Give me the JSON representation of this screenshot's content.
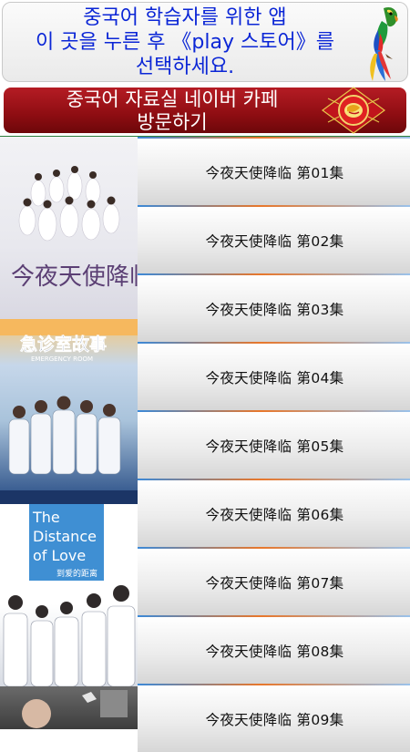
{
  "top_banner": {
    "line1": "중국어 학습자를 위한 앱",
    "line2": "이 곳을 누른 후 《play 스토어》를",
    "line3": "선택하세요.",
    "icon": "parrot-icon"
  },
  "cafe_banner": {
    "line1": "중국어 자료실 네이버 카페",
    "line2": "방문하기",
    "icon": "lantern-emblem-icon"
  },
  "posters": [
    {
      "title": "今夜天使降临"
    },
    {
      "title": "急诊室故事",
      "subtitle": "EMERGENCY ROOM"
    },
    {
      "title_line1": "The",
      "title_line2": "Distance",
      "title_line3": "of Love",
      "subtitle": "到爱的距离"
    },
    {
      "title": ""
    }
  ],
  "episodes": [
    {
      "label": "今夜天使降临 第01集"
    },
    {
      "label": "今夜天使降临 第02集"
    },
    {
      "label": "今夜天使降临 第03集"
    },
    {
      "label": "今夜天使降临 第04集"
    },
    {
      "label": "今夜天使降临 第05集"
    },
    {
      "label": "今夜天使降临 第06集"
    },
    {
      "label": "今夜天使降临 第07集"
    },
    {
      "label": "今夜天使降临 第08集"
    },
    {
      "label": "今夜天使降临 第09集"
    }
  ],
  "colors": {
    "banner_text": "#0b26d6",
    "cafe_red": "#9d121a",
    "stripe_orange": "#e8772b",
    "stripe_blue": "#3b89d8"
  }
}
